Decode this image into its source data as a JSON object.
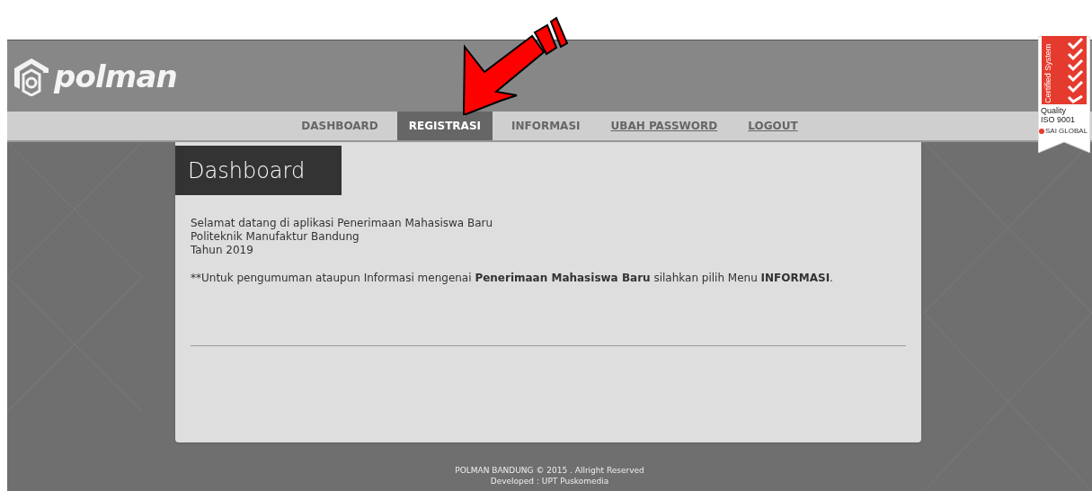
{
  "header": {
    "logo_text": "polman"
  },
  "nav": [
    {
      "label": "DASHBOARD",
      "selected": false,
      "underlined": false
    },
    {
      "label": "REGISTRASI",
      "selected": true,
      "underlined": false
    },
    {
      "label": "INFORMASI",
      "selected": false,
      "underlined": false
    },
    {
      "label": "UBAH PASSWORD",
      "selected": false,
      "underlined": true
    },
    {
      "label": "LOGOUT",
      "selected": false,
      "underlined": true
    }
  ],
  "badge": {
    "vertical_text": "Certified System",
    "lines": [
      "Quality",
      "ISO 9001"
    ],
    "brand": "SAI GLOBAL"
  },
  "card": {
    "title": "Dashboard",
    "lines": [
      "Selamat datang di aplikasi Penerimaan Mahasiswa Baru",
      "Politeknik Manufaktur Bandung",
      "Tahun 2019"
    ],
    "note": [
      {
        "text": "**Untuk pengumuman ataupun Informasi mengenai ",
        "bold": false
      },
      {
        "text": "Penerimaan Mahasiswa Baru",
        "bold": true
      },
      {
        "text": " silahkan pilih Menu ",
        "bold": false
      },
      {
        "text": "INFORMASI",
        "bold": true
      },
      {
        "text": ".",
        "bold": false
      }
    ]
  },
  "footer": [
    "POLMAN BANDUNG © 2015 . Allright Reserved",
    "Developed : UPT Puskomedia"
  ]
}
